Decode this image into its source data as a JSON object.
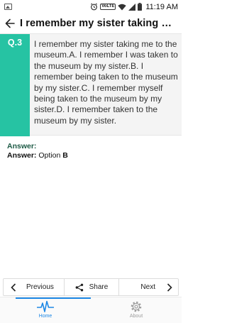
{
  "status_bar": {
    "time": "11:19 AM",
    "volte_label": "VoLTE",
    "icons": [
      "gallery-icon",
      "alarm-icon",
      "volte-icon",
      "wifi-icon",
      "signal-icon",
      "battery-icon"
    ]
  },
  "toolbar": {
    "title": "I remember my sister taking me t...",
    "back_icon": "arrow-left-icon"
  },
  "question": {
    "number": "Q.3",
    "text": "I remember my sister taking me to the museum.A. I remember I was taken to the museum by my sister.B. I remember being taken to the museum by my sister.C. I remember myself being taken to the museum by my sister.D. I remember taken to the museum by my sister."
  },
  "answer": {
    "heading": "Answer:",
    "label": "Answer:",
    "prefix": "Option",
    "option": "B"
  },
  "nav_buttons": {
    "previous": "Previous",
    "share": "Share",
    "next": "Next"
  },
  "tabs": [
    {
      "label": "Home",
      "icon": "heartbeat-icon",
      "active": true
    },
    {
      "label": "About",
      "icon": "gear-icon",
      "active": false
    }
  ],
  "colors": {
    "accent_green": "#26c3a3",
    "answer_heading": "#1d5a45",
    "tab_active": "#1e88e5",
    "tab_inactive": "#9e9e9e"
  }
}
